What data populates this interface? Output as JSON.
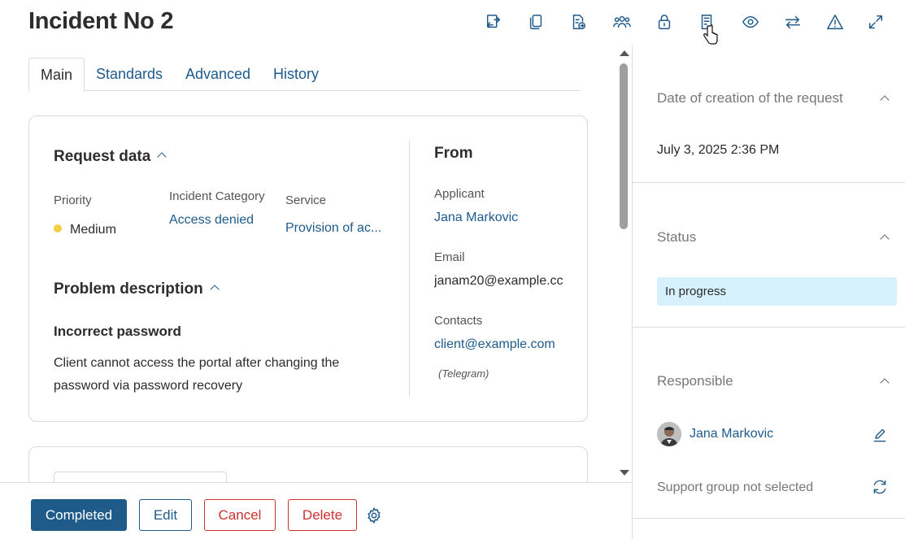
{
  "header": {
    "title": "Incident No 2"
  },
  "toolbar": {
    "icons": [
      "transfer-icon",
      "copy-icon",
      "export-icon",
      "group-icon",
      "lock-icon",
      "document-icon",
      "eye-icon",
      "swap-icon",
      "warning-icon",
      "expand-icon"
    ]
  },
  "tabs": [
    {
      "label": "Main",
      "active": true
    },
    {
      "label": "Standards"
    },
    {
      "label": "Advanced"
    },
    {
      "label": "History"
    }
  ],
  "request_data": {
    "title": "Request data",
    "priority_label": "Priority",
    "priority_value": "Medium",
    "priority_color": "#f3cf45",
    "category_label": "Incident Category",
    "category_value": "Access denied",
    "service_label": "Service",
    "service_value": "Provision of ac..."
  },
  "problem": {
    "title": "Problem description",
    "subject": "Incorrect password",
    "line1": "Client cannot access the portal after changing the",
    "line2": "password via password recovery"
  },
  "from": {
    "title": "From",
    "applicant_label": "Applicant",
    "applicant_value": "Jana Markovic",
    "email_label": "Email",
    "email_value": "janam20@example.cc",
    "contacts_label": "Contacts",
    "contacts_value": "client@example.com",
    "contacts_channel": "(Telegram)"
  },
  "footer": {
    "completed": "Completed",
    "edit": "Edit",
    "cancel": "Cancel",
    "delete": "Delete"
  },
  "side": {
    "date_label": "Date of creation of the request",
    "date_value": "July 3, 2025 2:36 PM",
    "status_label": "Status",
    "status_value": "In progress",
    "responsible_label": "Responsible",
    "responsible_value": "Jana Markovic",
    "support_group": "Support group not selected"
  },
  "colors": {
    "accent": "#1e5a8c",
    "primary_button": "#1f5b8a",
    "danger": "#d0312d",
    "status_bg": "#d6f1fb"
  }
}
